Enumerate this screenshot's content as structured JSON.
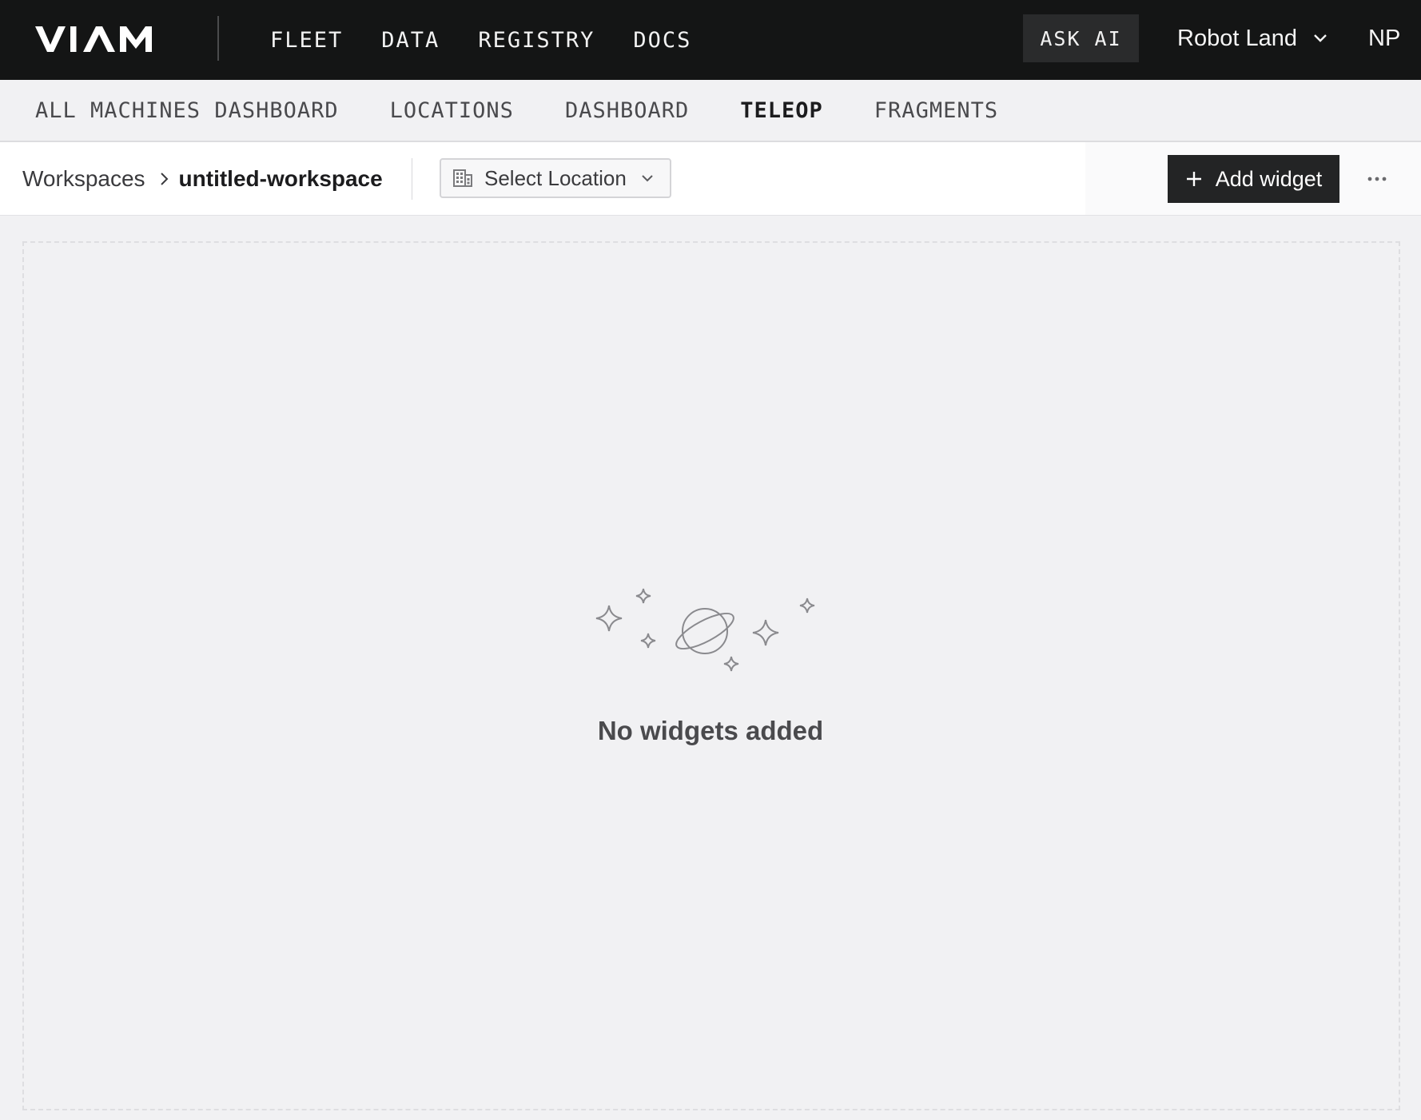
{
  "topbar": {
    "logo_alt": "VIAM",
    "nav": [
      "FLEET",
      "DATA",
      "REGISTRY",
      "DOCS"
    ],
    "ask_ai": "ASK AI",
    "org_name": "Robot Land",
    "avatar_initials": "NP"
  },
  "subnav": {
    "tabs": [
      "ALL MACHINES DASHBOARD",
      "LOCATIONS",
      "DASHBOARD",
      "TELEOP",
      "FRAGMENTS"
    ],
    "active_tab": "TELEOP"
  },
  "toolbar": {
    "breadcrumb_root": "Workspaces",
    "breadcrumb_current": "untitled-workspace",
    "location_select": "Select Location",
    "add_widget": "Add widget"
  },
  "canvas": {
    "empty_message": "No widgets added"
  },
  "icons": [
    "building-icon",
    "chevron-down-icon",
    "chevron-right-icon",
    "plus-icon",
    "more-horizontal-icon",
    "planet-icon",
    "sparkle-icon"
  ],
  "colors": {
    "topbar_bg": "#141515",
    "page_bg": "#f1f1f3",
    "button_dark": "#232425"
  }
}
